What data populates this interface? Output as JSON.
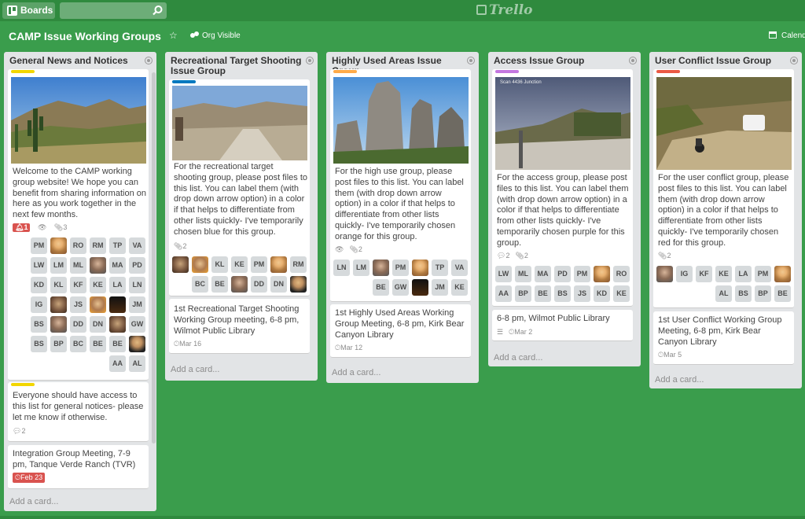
{
  "header": {
    "boards_label": "Boards",
    "logo_text": "Trello"
  },
  "board": {
    "title": "CAMP Issue Working Groups",
    "visibility": "Org Visible",
    "calendar_label": "Calend"
  },
  "colors": {
    "background": "#3a9d4c",
    "label_yellow": "#f2d600",
    "label_blue": "#0079bf",
    "label_orange": "#ffab4a",
    "label_purple": "#c377e0",
    "label_red": "#eb5a46",
    "badge_red": "#d9534f"
  },
  "lists": [
    {
      "title": "General News and Notices",
      "add_card": "Add a card...",
      "cards": [
        {
          "label_color": "#f2d600",
          "text": "Welcome to the CAMP working group website! We hope you can benefit from sharing information on here as you work together in the next few months.",
          "badges": {
            "notifications": "1",
            "attachments": "3"
          },
          "members": [
            "PM",
            "@f1",
            "RO",
            "RM",
            "TP",
            "VA",
            "LW",
            "LM",
            "ML",
            "@f6",
            "MA",
            "PD",
            "KD",
            "KL",
            "KF",
            "KE",
            "LA",
            "LN",
            "IG",
            "@f2",
            "JS",
            "@f5",
            "@f4",
            "JM",
            "BS",
            "@f6",
            "DD",
            "DN",
            "@f2",
            "GW",
            "BS",
            "BP",
            "BC",
            "BE",
            "BE",
            "@f3",
            "AA",
            "AL"
          ]
        },
        {
          "label_color": "#f2d600",
          "text": "Everyone should have access to this list for general notices- please let me know if otherwise.",
          "badges": {
            "comments": "2"
          }
        },
        {
          "text": "Integration Group Meeting, 7-9 pm, Tanque Verde Ranch (TVR)",
          "badges": {
            "due": "Feb 23"
          }
        }
      ]
    },
    {
      "title": "Recreational Target Shooting Issue Group",
      "add_card": "Add a card...",
      "cards": [
        {
          "label_color": "#0079bf",
          "text": "For the recreational target shooting group, please post files to this list. You can label them (with drop down arrow option) in a color if that helps to differentiate from other lists quickly- I've temporarily chosen blue for this group.",
          "badges": {
            "attachments": "2"
          },
          "members": [
            "@f2",
            "@f5",
            "KL",
            "KE",
            "PM",
            "@f1",
            "RM",
            "BC",
            "BE",
            "@f6",
            "DD",
            "DN",
            "@f3"
          ]
        },
        {
          "text": "1st Recreational Target Shooting Working Group meeting, 6-8 pm, Wilmot Public Library",
          "badges": {
            "due": "Mar 16"
          }
        }
      ]
    },
    {
      "title": "Highly Used Areas Issue Group",
      "add_card": "Add a card...",
      "cards": [
        {
          "label_color": "#ffab4a",
          "text": "For the high use group, please post files to this list. You can label them (with drop down arrow option) in a color if that helps to differentiate from other lists quickly- I've temporarily chosen orange for this group.",
          "badges": {
            "attachments": "2"
          },
          "members": [
            "LN",
            "LM",
            "@f6",
            "PM",
            "@f1",
            "TP",
            "VA",
            "BE",
            "GW",
            "@f4",
            "JM",
            "KE"
          ]
        },
        {
          "text": "1st Highly Used Areas Working Group Meeting, 6-8 pm, Kirk Bear Canyon Library",
          "badges": {
            "due": "Mar 12"
          }
        }
      ]
    },
    {
      "title": "Access Issue Group",
      "add_card": "Add a card...",
      "cards": [
        {
          "label_color": "#c377e0",
          "text": "For the access group, please post files to this list. You can label them (with drop down arrow option) in a color if that helps to differentiate from other lists quickly- I've temporarily chosen purple for this group.",
          "badges": {
            "comments": "2",
            "attachments": "2"
          },
          "cover_caption": "Scan 4436 Junction",
          "members": [
            "LW",
            "ML",
            "MA",
            "PD",
            "PM",
            "@f1",
            "RO",
            "AA",
            "BP",
            "BE",
            "BS",
            "JS",
            "KD",
            "KE"
          ]
        },
        {
          "text": "6-8 pm, Wilmot Public Library",
          "badges": {
            "due": "Mar 2"
          }
        }
      ]
    },
    {
      "title": "User Conflict Issue Group",
      "add_card": "Add a card...",
      "cards": [
        {
          "label_color": "#eb5a46",
          "text": "For the user conflict group, please post files to this list. You can label them (with drop down arrow option) in a color if that helps to differentiate from other lists quickly- I've temporarily chosen red for this group.",
          "badges": {
            "attachments": "2"
          },
          "members": [
            "@f6",
            "IG",
            "KF",
            "KE",
            "LA",
            "PM",
            "@f1",
            "AL",
            "BS",
            "BP",
            "BE"
          ]
        },
        {
          "text": "1st User Conflict Working Group Meeting, 6-8 pm, Kirk Bear Canyon Library",
          "badges": {
            "due": "Mar 5"
          }
        }
      ]
    }
  ]
}
